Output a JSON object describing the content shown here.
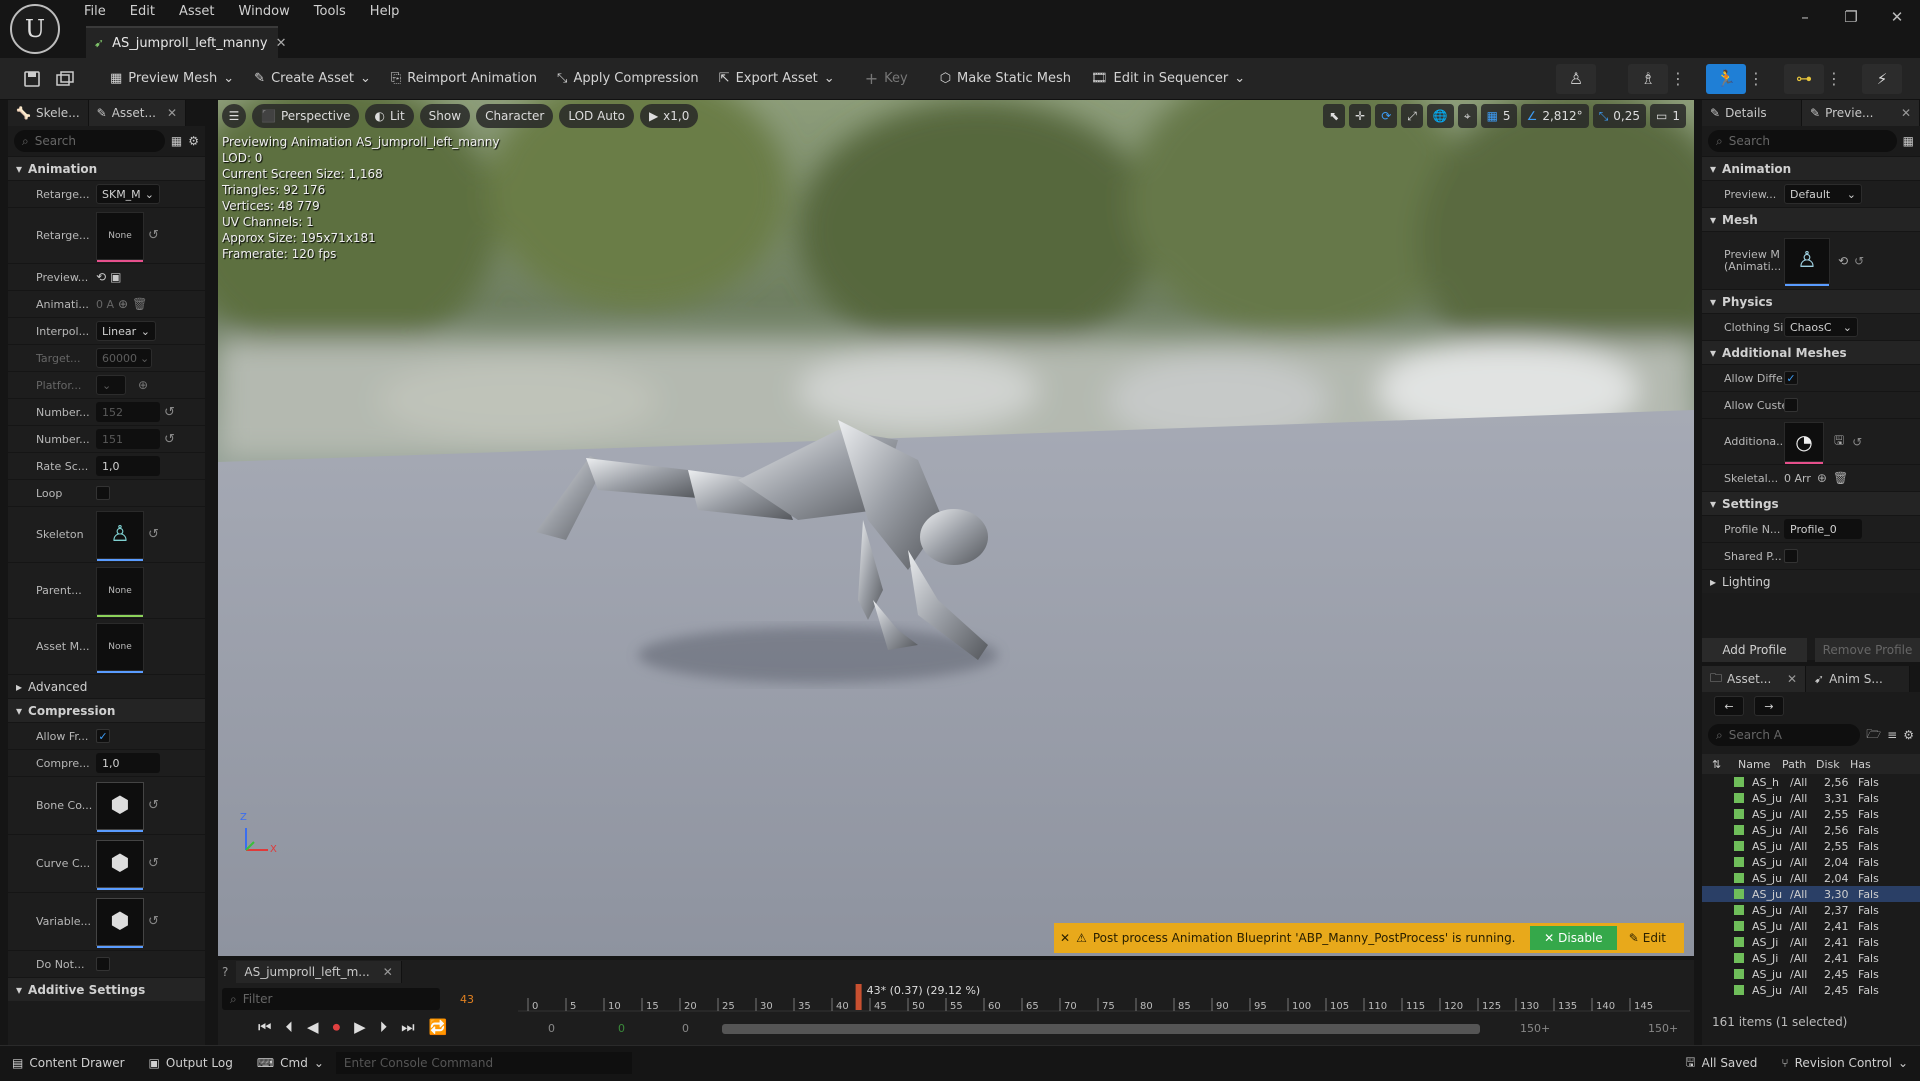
{
  "app": {
    "menu": [
      "File",
      "Edit",
      "Asset",
      "Window",
      "Tools",
      "Help"
    ],
    "asset_tab": "AS_jumproll_left_manny",
    "window_controls": [
      "–",
      "❐",
      "✕"
    ]
  },
  "toolbar": {
    "preview_mesh": "Preview Mesh",
    "create_asset": "Create Asset",
    "reimport_animation": "Reimport Animation",
    "apply_compression": "Apply Compression",
    "export_asset": "Export Asset",
    "key": "Key",
    "make_static_mesh": "Make Static Mesh",
    "edit_in_sequencer": "Edit in Sequencer"
  },
  "left_panel": {
    "tabs": [
      "Skele...",
      "Asset..."
    ],
    "search_placeholder": "Search",
    "sections": {
      "animation": "Animation",
      "advanced": "Advanced",
      "compression": "Compression",
      "additive": "Additive Settings"
    },
    "rows": {
      "retarget1": {
        "label": "Retarge...",
        "value": "SKM_M"
      },
      "retarget2": {
        "label": "Retarge...",
        "value": "None"
      },
      "preview": {
        "label": "Preview..."
      },
      "animati": {
        "label": "Animati...",
        "value": "0 A"
      },
      "interpol": {
        "label": "Interpol...",
        "value": "Linear"
      },
      "target": {
        "label": "Target...",
        "value": "60000"
      },
      "platfor": {
        "label": "Platfor..."
      },
      "number1": {
        "label": "Number...",
        "value": "152"
      },
      "number2": {
        "label": "Number...",
        "value": "151"
      },
      "ratesc": {
        "label": "Rate Sc...",
        "value": "1,0"
      },
      "loop": {
        "label": "Loop"
      },
      "skeleton": {
        "label": "Skeleton"
      },
      "parent": {
        "label": "Parent...",
        "value": "None"
      },
      "assetm": {
        "label": "Asset M...",
        "value": "None"
      },
      "allowfr": {
        "label": "Allow Fr..."
      },
      "compre": {
        "label": "Compre...",
        "value": "1,0"
      },
      "boneco": {
        "label": "Bone Co..."
      },
      "curvec": {
        "label": "Curve C..."
      },
      "variable": {
        "label": "Variable..."
      },
      "donot": {
        "label": "Do Not..."
      }
    }
  },
  "viewport": {
    "perspective": "Perspective",
    "lit": "Lit",
    "show": "Show",
    "character": "Character",
    "lod": "LOD Auto",
    "speed": "x1,0",
    "grid_value": "5",
    "angle_value": "2,812°",
    "scale_value": "0,25",
    "camera_value": "1",
    "stats": [
      "Previewing Animation AS_jumproll_left_manny",
      "LOD: 0",
      "Current Screen Size: 1,168",
      "Triangles: 92 176",
      "Vertices: 48 779",
      "UV Channels: 1",
      "Approx Size: 195x71x181",
      "Framerate: 120 fps"
    ],
    "warning": "Post process Animation Blueprint 'ABP_Manny_PostProcess' is running.",
    "disable": "Disable",
    "edit": "Edit",
    "axis_z": "Z",
    "axis_x": "X"
  },
  "details": {
    "tabs": [
      "Details",
      "Previe..."
    ],
    "search_placeholder": "Search",
    "sections": {
      "animation": "Animation",
      "mesh": "Mesh",
      "physics": "Physics",
      "additional": "Additional Meshes",
      "settings": "Settings",
      "lighting": "Lighting"
    },
    "rows": {
      "preview": {
        "label": "Preview...",
        "value": "Default"
      },
      "preview_mesh": {
        "label": "Preview M\n(Animati..."
      },
      "clothing": {
        "label": "Clothing Si",
        "value": "ChaosC"
      },
      "allow_diff": {
        "label": "Allow Diffe"
      },
      "allow_cust": {
        "label": "Allow Custe"
      },
      "additiona": {
        "label": "Additiona..."
      },
      "skeletal": {
        "label": "Skeletal...",
        "value": "0 Arr"
      },
      "profile_n": {
        "label": "Profile N...",
        "value": "Profile_0"
      },
      "shared_p": {
        "label": "Shared P..."
      }
    },
    "add_profile": "Add Profile",
    "remove_profile": "Remove Profile"
  },
  "asset_browser": {
    "tabs": [
      "Asset...",
      "Anim S..."
    ],
    "search_placeholder": "Search A",
    "columns": [
      "Name",
      "Path",
      "Disk",
      "Has"
    ],
    "rows": [
      {
        "name": "AS_h",
        "path": "/All",
        "disk": "2,56",
        "has": "Fals"
      },
      {
        "name": "AS_ju",
        "path": "/All",
        "disk": "3,31",
        "has": "Fals"
      },
      {
        "name": "AS_ju",
        "path": "/All",
        "disk": "2,55",
        "has": "Fals"
      },
      {
        "name": "AS_ju",
        "path": "/All",
        "disk": "2,56",
        "has": "Fals"
      },
      {
        "name": "AS_ju",
        "path": "/All",
        "disk": "2,55",
        "has": "Fals"
      },
      {
        "name": "AS_ju",
        "path": "/All",
        "disk": "2,04",
        "has": "Fals"
      },
      {
        "name": "AS_ju",
        "path": "/All",
        "disk": "2,04",
        "has": "Fals"
      },
      {
        "name": "AS_ju",
        "path": "/All",
        "disk": "3,30",
        "has": "Fals"
      },
      {
        "name": "AS_ju",
        "path": "/All",
        "disk": "2,37",
        "has": "Fals"
      },
      {
        "name": "AS_Ju",
        "path": "/All",
        "disk": "2,41",
        "has": "Fals"
      },
      {
        "name": "AS_Ji",
        "path": "/All",
        "disk": "2,41",
        "has": "Fals"
      },
      {
        "name": "AS_Ji",
        "path": "/All",
        "disk": "2,41",
        "has": "Fals"
      },
      {
        "name": "AS_ju",
        "path": "/All",
        "disk": "2,45",
        "has": "Fals"
      },
      {
        "name": "AS_ju",
        "path": "/All",
        "disk": "2,45",
        "has": "Fals"
      }
    ],
    "selected_index": 7,
    "footer": "161 items (1 selected)"
  },
  "timeline": {
    "tab": "AS_jumproll_left_m...",
    "filter_placeholder": "Filter",
    "current_frame": "43",
    "playhead_label": "43* (0.37) (29.12 %)",
    "ticks": [
      "0",
      "5",
      "10",
      "15",
      "20",
      "25",
      "30",
      "35",
      "40",
      "45",
      "50",
      "55",
      "60",
      "65",
      "70",
      "75",
      "80",
      "85",
      "90",
      "95",
      "100",
      "105",
      "110",
      "115",
      "120",
      "125",
      "130",
      "135",
      "140",
      "145"
    ],
    "range_start": "0",
    "range_start2": "0",
    "range_start3": "0",
    "range_end": "150+",
    "range_end2": "150+",
    "playhead_fraction": 0.29
  },
  "statusbar": {
    "content_drawer": "Content Drawer",
    "output_log": "Output Log",
    "cmd": "Cmd",
    "console_placeholder": "Enter Console Command",
    "all_saved": "All Saved",
    "revision_control": "Revision Control"
  }
}
